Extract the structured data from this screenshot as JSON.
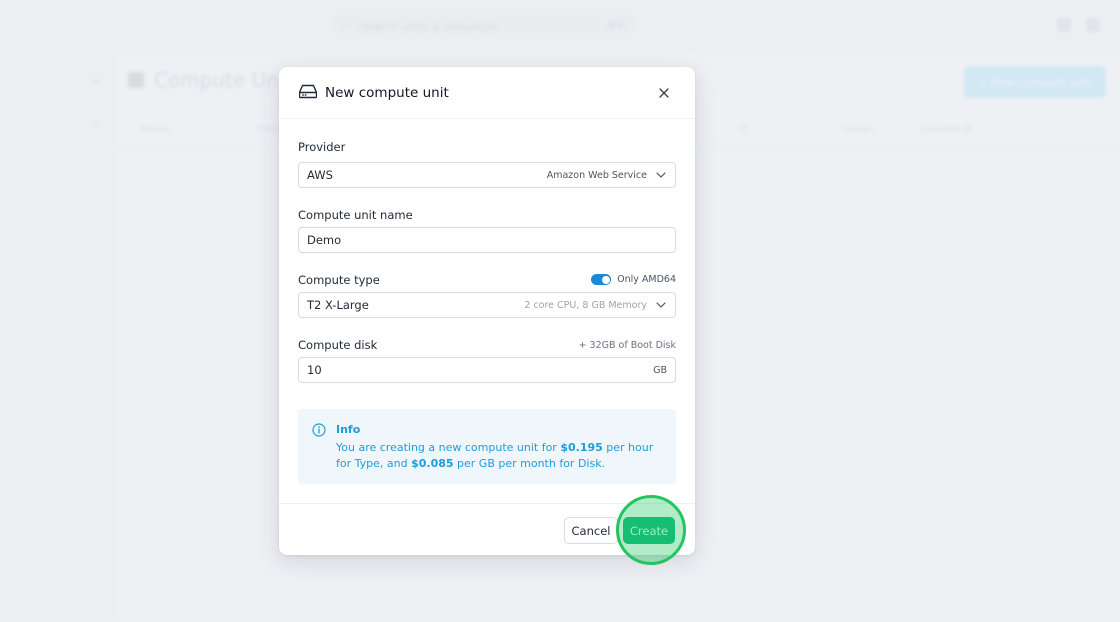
{
  "background": {
    "search_placeholder": "Search units & resources",
    "search_shortcut": "⌘K",
    "page_title": "Compute Units",
    "add_button_label": "+ New compute unit",
    "table_headers": [
      "Name",
      "Provider",
      "IP",
      "Usage",
      "Created At"
    ]
  },
  "modal": {
    "icon": "hard-drive-icon",
    "title": "New compute unit",
    "close_icon": "close-icon",
    "provider": {
      "label": "Provider",
      "value": "AWS",
      "hint": "Amazon Web Service",
      "icon": "chevron-down-icon"
    },
    "name": {
      "label": "Compute unit name",
      "value": "Demo"
    },
    "type": {
      "label": "Compute type",
      "toggle_label": "Only AMD64",
      "toggle_on": true,
      "value": "T2 X-Large",
      "hint": "2 core CPU, 8 GB Memory",
      "icon": "chevron-down-icon"
    },
    "disk": {
      "label": "Compute disk",
      "aux": "+ 32GB of Boot Disk",
      "value": "10",
      "unit": "GB"
    },
    "info": {
      "icon": "info-icon",
      "title": "Info",
      "text_part1": "You are creating a new compute unit for ",
      "price_hour": "$0.195",
      "text_part2": " per hour for Type, and ",
      "price_gb": "$0.085",
      "text_part3": " per GB per month for Disk."
    },
    "footer": {
      "cancel_label": "Cancel",
      "create_label": "Create"
    }
  },
  "colors": {
    "accent_blue": "#1e88d6",
    "info_text": "#1f9cd8",
    "create_green": "#10b981",
    "highlight": "#22c55e"
  }
}
